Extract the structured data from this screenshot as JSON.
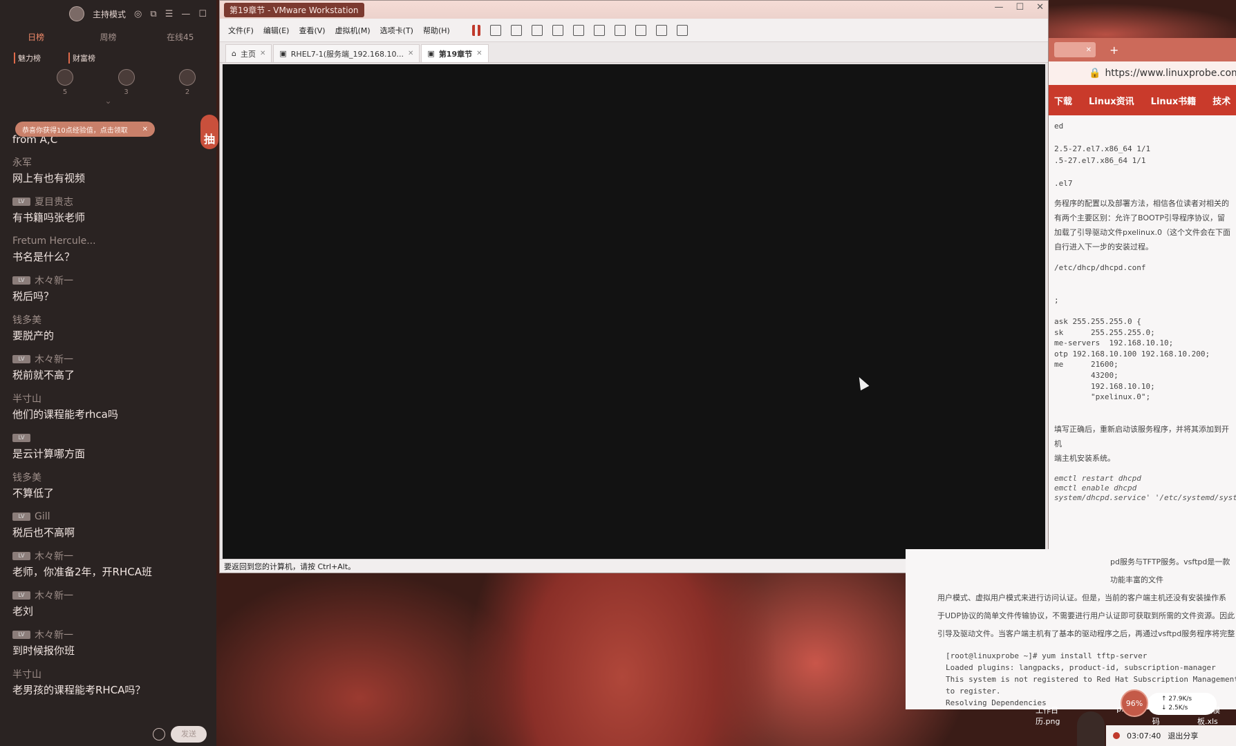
{
  "live": {
    "header": {
      "mode": "主持模式"
    },
    "tabs": [
      "日榜",
      "周榜",
      "在线45"
    ],
    "rank_subs": [
      "魅力榜",
      "财富榜"
    ],
    "rank_counts": [
      "5",
      "3",
      "2"
    ],
    "notice": "恭喜你获得10点经验值，点击领取",
    "lucky": "抽",
    "messages": [
      {
        "name": "",
        "text": "from A,C"
      },
      {
        "name": "永军",
        "text": "网上有也有视频"
      },
      {
        "name": "夏目贵志",
        "text": "有书籍吗张老师",
        "badge": true
      },
      {
        "name": "Fretum Hercule...",
        "text": "书名是什么？"
      },
      {
        "name": "木々新一",
        "text": "税后吗？",
        "badge": true
      },
      {
        "name": "钱多美",
        "text": "要脱产的"
      },
      {
        "name": "木々新一",
        "text": "税前就不高了",
        "badge": true
      },
      {
        "name": "半寸山",
        "text": "他们的课程能考rhca吗"
      },
      {
        "name": "",
        "text": "是云计算哪方面",
        "badge": true
      },
      {
        "name": "钱多美",
        "text": "不算低了"
      },
      {
        "name": "Gill",
        "text": "税后也不高啊",
        "badge": true
      },
      {
        "name": "木々新一",
        "text": "老师，你准备2年，开RHCA班",
        "badge": true
      },
      {
        "name": "木々新一",
        "text": "老刘",
        "badge": true
      },
      {
        "name": "木々新一",
        "text": "到时候报你班",
        "badge": true
      },
      {
        "name": "半寸山",
        "text": "老男孩的课程能考RHCA吗？"
      }
    ],
    "send_label": "发送"
  },
  "vmware": {
    "title": "第19章节 - VMware Workstation",
    "menu": [
      "文件(F)",
      "编辑(E)",
      "查看(V)",
      "虚拟机(M)",
      "选项卡(T)",
      "帮助(H)"
    ],
    "tabs": [
      "主页",
      "RHEL7-1(服务端_192.168.10...",
      "第19章节"
    ],
    "status": "要返回到您的计算机，请按 Ctrl+Alt。"
  },
  "browser": {
    "url": "https://www.linuxprobe.com",
    "nav": [
      "下载",
      "Linux资讯",
      "Linux书籍",
      "技术"
    ],
    "code1": "ed\n\n2.5-27.el7.x86_64 1/1\n.5-27.el7.x86_64 1/1\n\n.el7",
    "para1": [
      "务程序的配置以及部署方法，相信各位读者对相关的",
      "有两个主要区别：允许了BOOTP引导程序协议，留",
      "加载了引导驱动文件pxelinux.0（这个文件会在下面",
      "自行进入下一步的安装过程。"
    ],
    "code2": "/etc/dhcp/dhcpd.conf\n\n\n;\n\nask 255.255.255.0 {\nsk      255.255.255.0;\nme-servers  192.168.10.10;\notp 192.168.10.100 192.168.10.200;\nme      21600;\n        43200;\n        192.168.10.10;\n        \"pxelinux.0\";",
    "para2": [
      "填写正确后，重新启动该服务程序，并将其添加到开机",
      "端主机安装系统。"
    ],
    "code3": "emctl restart dhcpd\nemctl enable dhcpd\nsystem/dhcpd.service' '/etc/systemd/syste"
  },
  "doc2": {
    "para": [
      "pd服务与TFTP服务。vsftpd是一款功能丰富的文件",
      "用户模式、虚拟用户模式来进行访问认证。但是，当前的客户端主机还没有安装操作系",
      "于UDP协议的简单文件传输协议，不需要进行用户认证即可获取到所需的文件资源。因此",
      "引导及驱动文件。当客户端主机有了基本的驱动程序之后，再通过vsftpd服务程序将完整"
    ],
    "code": "[root@linuxprobe ~]# yum install tftp-server\nLoaded plugins: langpacks, product-id, subscription-manager\nThis system is not registered to Red Hat Subscription Management.\nto register.\nResolving Dependencies"
  },
  "desktop": {
    "icons": [
      "工作日历.png",
      "p.txt",
      "微信号码",
      "收据模板.xls"
    ],
    "cpu": "96%",
    "up": "27.9K/s",
    "down": "2.5K/s",
    "timer": "03:07:40",
    "exit_share": "退出分享"
  }
}
